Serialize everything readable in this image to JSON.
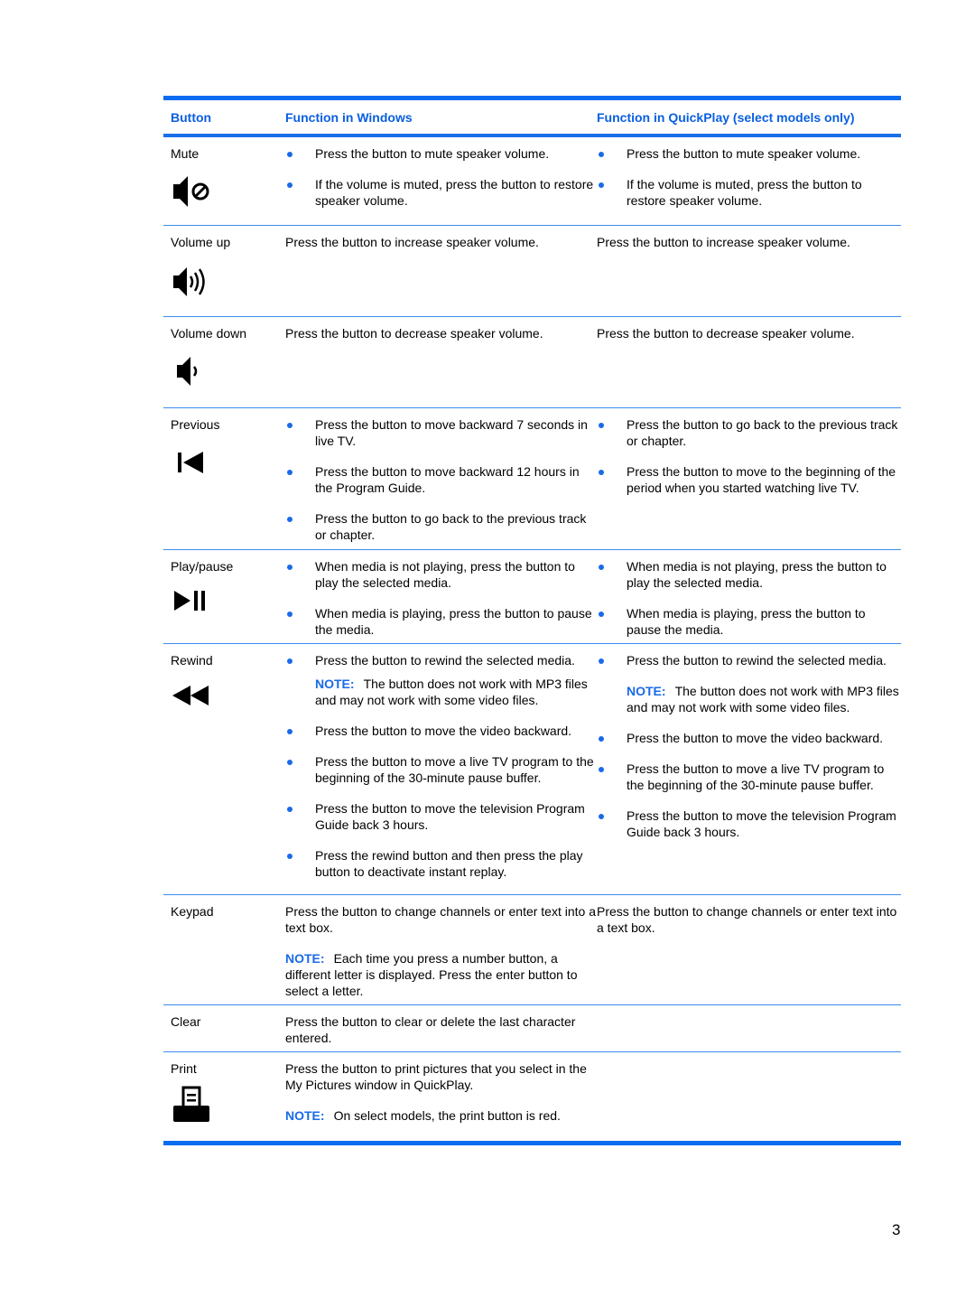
{
  "table": {
    "headers": {
      "button": "Button",
      "windows": "Function in Windows",
      "quickplay": "Function in QuickPlay (select models only)"
    },
    "rows": [
      {
        "label": "Mute",
        "icon": "mute-icon",
        "windows": {
          "bullets": [
            "Press the button to mute speaker volume.",
            "If the volume is muted, press the button to restore speaker volume."
          ]
        },
        "quickplay": {
          "bullets": [
            "Press the button to mute speaker volume.",
            "If the volume is muted, press the button to restore speaker volume."
          ]
        }
      },
      {
        "label": "Volume up",
        "icon": "volume-up-icon",
        "windows": {
          "text": "Press the button to increase speaker volume."
        },
        "quickplay": {
          "text": "Press the button to increase speaker volume."
        }
      },
      {
        "label": "Volume down",
        "icon": "volume-down-icon",
        "windows": {
          "text": "Press the button to decrease speaker volume."
        },
        "quickplay": {
          "text": "Press the button to decrease speaker volume."
        }
      },
      {
        "label": "Previous",
        "icon": "previous-icon",
        "windows": {
          "bullets": [
            "Press the button to move backward 7 seconds in live TV.",
            "Press the button to move backward 12 hours in the Program Guide.",
            "Press the button to go back to the previous track or chapter."
          ]
        },
        "quickplay": {
          "bullets": [
            "Press the button to go back to the previous track or chapter.",
            "Press the button to move to the beginning of the period when you started watching live TV."
          ]
        }
      },
      {
        "label": "Play/pause",
        "icon": "play-pause-icon",
        "windows": {
          "bullets": [
            "When media is not playing, press the button to play the selected media.",
            "When media is playing, press the button to pause the media."
          ]
        },
        "quickplay": {
          "bullets": [
            "When media is not playing, press the button to play the selected media.",
            "When media is playing, press the button to pause the media."
          ]
        }
      },
      {
        "label": "Rewind",
        "icon": "rewind-icon",
        "windows": {
          "bullet1": "Press the button to rewind the selected media.",
          "note": "The button does not work with MP3 files and may not work with some video files.",
          "bullets_after": [
            "Press the button to move the video backward.",
            "Press the button to move a live TV program to the beginning of the 30-minute pause buffer.",
            "Press the button to move the television Program Guide back 3 hours.",
            "Press the rewind button and then press the play button to deactivate instant replay."
          ]
        },
        "quickplay": {
          "bullet1": "Press the button to rewind the selected media.",
          "note": "The button does not work with MP3 files and may not work with some video files.",
          "bullets_after": [
            "Press the button to move the video backward.",
            "Press the button to move a live TV program to the beginning of the 30-minute pause buffer.",
            "Press the button to move the television Program Guide back 3 hours."
          ]
        }
      },
      {
        "label": "Keypad",
        "windows": {
          "text": "Press the button to change channels or enter text into a text box.",
          "note": "Each time you press a number button, a different letter is displayed. Press the enter button to select a letter."
        },
        "quickplay": {
          "text": "Press the button to change channels or enter text into a text box."
        }
      },
      {
        "label": "Clear",
        "windows": {
          "text": "Press the button to clear or delete the last character entered."
        }
      },
      {
        "label": "Print",
        "icon": "print-icon",
        "windows": {
          "text": "Press the button to print pictures that you select in the My Pictures window in QuickPlay.",
          "note": "On select models, the print button is red."
        }
      }
    ],
    "note_label": "NOTE:"
  },
  "page_number": "3",
  "colors": {
    "accent": "#0a6cf0",
    "header_text": "#0a5fe0",
    "bullet": "#1a6ae8"
  }
}
